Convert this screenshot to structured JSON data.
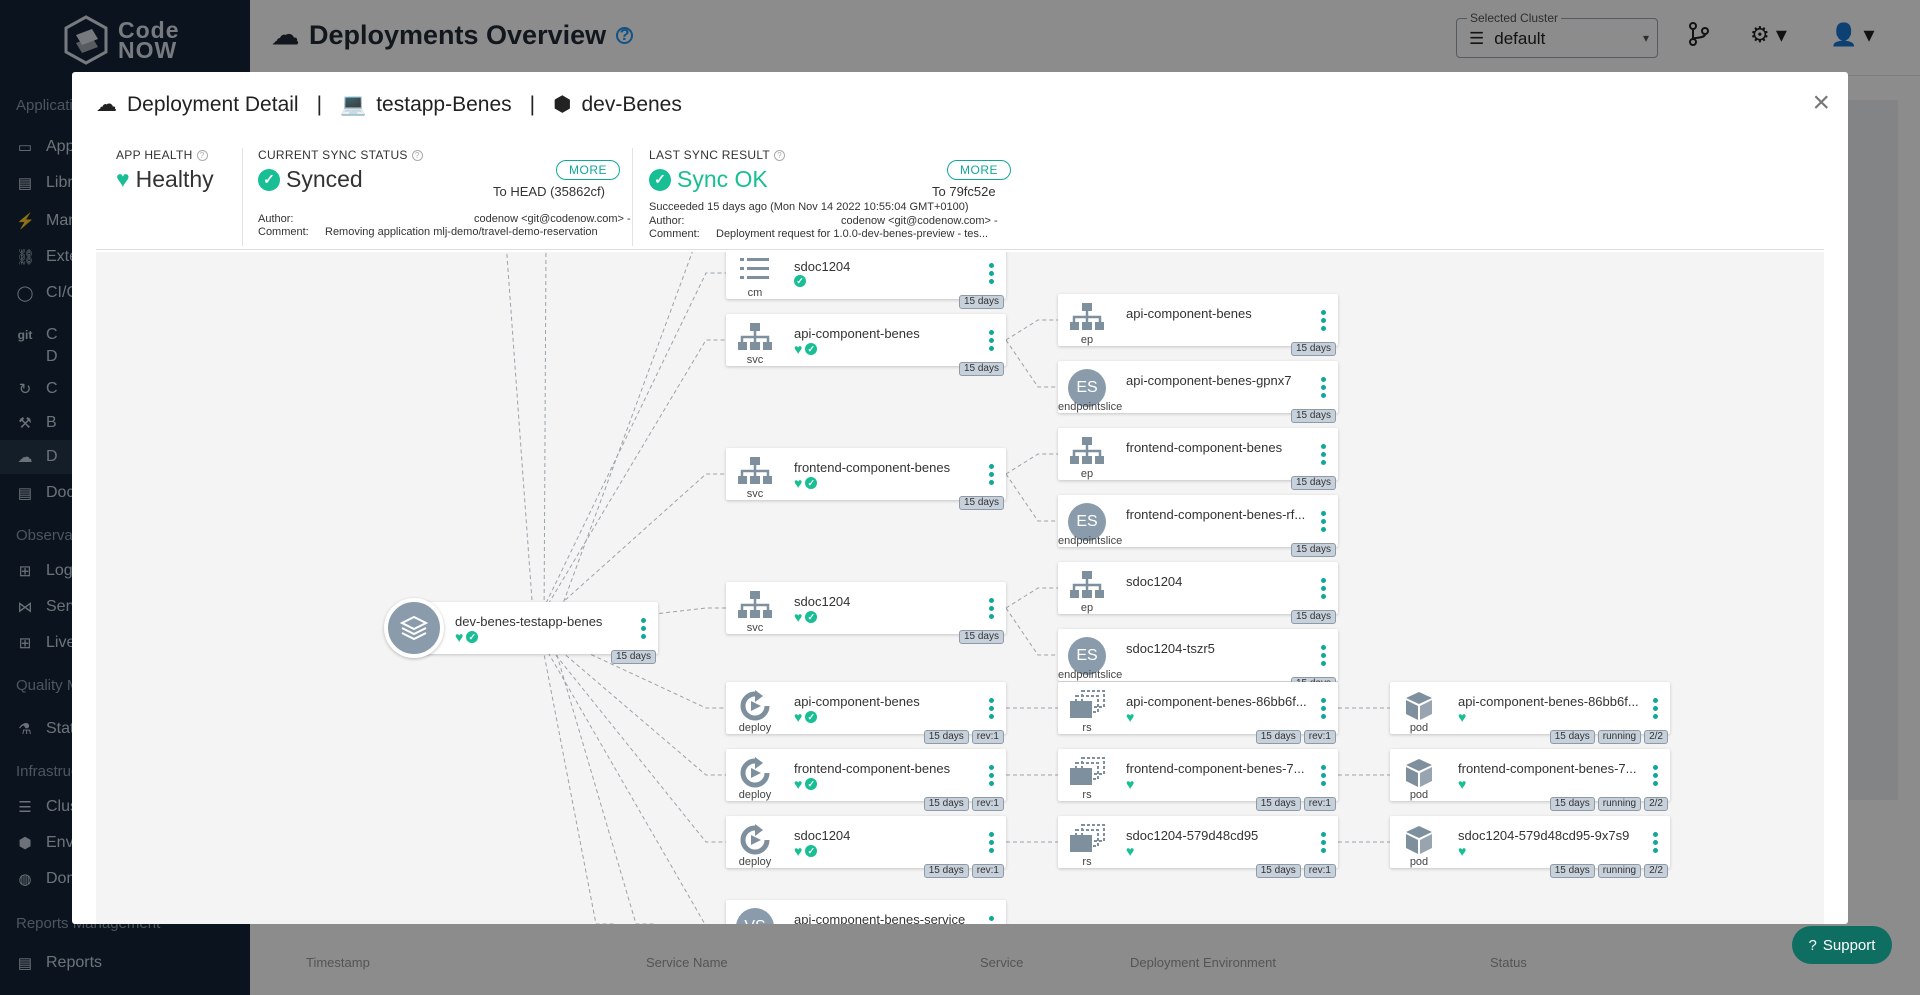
{
  "app": {
    "logo_line1": "Code",
    "logo_line2": "NOW"
  },
  "sidebar": {
    "items": [
      {
        "label": "Applications",
        "icon": "section"
      },
      {
        "label": "Applications",
        "icon": "laptop-icon"
      },
      {
        "label": "Libraries",
        "icon": "book-icon"
      },
      {
        "label": "Managed Services",
        "icon": "plug-icon"
      },
      {
        "label": "External Services",
        "icon": "link-icon"
      },
      {
        "label": "CI/CD",
        "icon": "cycle-icon"
      },
      {
        "label": "C",
        "icon": "git-icon"
      },
      {
        "label": "D",
        "icon": "none"
      },
      {
        "label": "C",
        "icon": "refresh-icon"
      },
      {
        "label": "B",
        "icon": "hammer-icon"
      },
      {
        "label": "D",
        "icon": "cloud-icon"
      },
      {
        "label": "Documentation",
        "icon": "book-icon"
      },
      {
        "label": "Observability",
        "icon": "section"
      },
      {
        "label": "Logs",
        "icon": "binoculars-icon"
      },
      {
        "label": "Services",
        "icon": "graph-icon"
      },
      {
        "label": "Live",
        "icon": "binoculars-icon"
      },
      {
        "label": "Quality Management",
        "icon": "section"
      },
      {
        "label": "Static",
        "icon": "flask-icon"
      },
      {
        "label": "Infrastructure",
        "icon": "section"
      },
      {
        "label": "Clusters",
        "icon": "list-icon"
      },
      {
        "label": "Environments",
        "icon": "cube-icon"
      },
      {
        "label": "Domains",
        "icon": "globe-icon"
      },
      {
        "label": "Reports Management",
        "icon": "section"
      },
      {
        "label": "Reports",
        "icon": "doc-icon"
      }
    ]
  },
  "header": {
    "title": "Deployments Overview",
    "cluster_label": "Selected Cluster",
    "cluster_value": "default"
  },
  "background_table": {
    "columns": [
      "Timestamp",
      "Service Name",
      "Service",
      "Deployment Environment",
      "Status"
    ]
  },
  "modal": {
    "title_part1": "Deployment Detail",
    "title_part2": "testapp-Benes",
    "title_part3": "dev-Benes",
    "separator": "|",
    "close": "×",
    "health": {
      "header": "APP HEALTH",
      "value": "Healthy"
    },
    "sync_status": {
      "header": "CURRENT SYNC STATUS",
      "value": "Synced",
      "more": "MORE",
      "target": "To HEAD (35862cf)",
      "author_label": "Author:",
      "author": "codenow <git@codenow.com> -",
      "comment_label": "Comment:",
      "comment": "Removing application mlj-demo/travel-demo-reservation"
    },
    "last_sync": {
      "header": "LAST SYNC RESULT",
      "value": "Sync OK",
      "more": "MORE",
      "target": "To 79fc52e",
      "succeeded": "Succeeded 15 days ago (Mon Nov 14 2022 10:55:04 GMT+0100)",
      "author_label": "Author:",
      "author": "codenow <git@codenow.com> -",
      "comment_label": "Comment:",
      "comment": "Deployment request for 1.0.0-dev-benes-preview - tes..."
    }
  },
  "graph": {
    "root": {
      "name": "dev-benes-testapp-benes",
      "age": "15 days"
    },
    "nodes": [
      {
        "id": "n1",
        "name": "sdoc1204",
        "kind": "cm",
        "icon": "list",
        "heart": false,
        "check": true,
        "tags": [
          "15 days"
        ]
      },
      {
        "id": "n2",
        "name": "api-component-benes",
        "kind": "svc",
        "icon": "tree",
        "heart": true,
        "check": true,
        "tags": [
          "15 days"
        ]
      },
      {
        "id": "n3",
        "name": "frontend-component-benes",
        "kind": "svc",
        "icon": "tree",
        "heart": true,
        "check": true,
        "tags": [
          "15 days"
        ]
      },
      {
        "id": "n4",
        "name": "sdoc1204",
        "kind": "svc",
        "icon": "tree",
        "heart": true,
        "check": true,
        "tags": [
          "15 days"
        ]
      },
      {
        "id": "n5",
        "name": "api-component-benes",
        "kind": "deploy",
        "icon": "deploy",
        "heart": true,
        "check": true,
        "tags": [
          "15 days",
          "rev:1"
        ]
      },
      {
        "id": "n6",
        "name": "frontend-component-benes",
        "kind": "deploy",
        "icon": "deploy",
        "heart": true,
        "check": true,
        "tags": [
          "15 days",
          "rev:1"
        ]
      },
      {
        "id": "n7",
        "name": "sdoc1204",
        "kind": "deploy",
        "icon": "deploy",
        "heart": true,
        "check": true,
        "tags": [
          "15 days",
          "rev:1"
        ]
      },
      {
        "id": "n8",
        "name": "api-component-benes-service",
        "kind": "",
        "icon": "vs",
        "heart": false,
        "check": false,
        "tags": []
      },
      {
        "id": "e1",
        "name": "api-component-benes",
        "kind": "ep",
        "icon": "tree",
        "heart": false,
        "check": false,
        "tags": [
          "15 days"
        ]
      },
      {
        "id": "e2",
        "name": "api-component-benes-gpnx7",
        "kind": "endpointslice",
        "icon": "es",
        "heart": false,
        "check": false,
        "tags": [
          "15 days"
        ]
      },
      {
        "id": "e3",
        "name": "frontend-component-benes",
        "kind": "ep",
        "icon": "tree",
        "heart": false,
        "check": false,
        "tags": [
          "15 days"
        ]
      },
      {
        "id": "e4",
        "name": "frontend-component-benes-rf...",
        "kind": "endpointslice",
        "icon": "es",
        "heart": false,
        "check": false,
        "tags": [
          "15 days"
        ]
      },
      {
        "id": "e5",
        "name": "sdoc1204",
        "kind": "ep",
        "icon": "tree",
        "heart": false,
        "check": false,
        "tags": [
          "15 days"
        ]
      },
      {
        "id": "e6",
        "name": "sdoc1204-tszr5",
        "kind": "endpointslice",
        "icon": "es",
        "heart": false,
        "check": false,
        "tags": [
          "15 days"
        ]
      },
      {
        "id": "r1",
        "name": "api-component-benes-86bb6f...",
        "kind": "rs",
        "icon": "rs",
        "heart": true,
        "check": false,
        "tags": [
          "15 days",
          "rev:1"
        ]
      },
      {
        "id": "r2",
        "name": "frontend-component-benes-7...",
        "kind": "rs",
        "icon": "rs",
        "heart": true,
        "check": false,
        "tags": [
          "15 days",
          "rev:1"
        ]
      },
      {
        "id": "r3",
        "name": "sdoc1204-579d48cd95",
        "kind": "rs",
        "icon": "rs",
        "heart": true,
        "check": false,
        "tags": [
          "15 days",
          "rev:1"
        ]
      },
      {
        "id": "p1",
        "name": "api-component-benes-86bb6f...",
        "kind": "pod",
        "icon": "pod",
        "heart": true,
        "check": false,
        "tags": [
          "15 days",
          "running",
          "2/2"
        ]
      },
      {
        "id": "p2",
        "name": "frontend-component-benes-7...",
        "kind": "pod",
        "icon": "pod",
        "heart": true,
        "check": false,
        "tags": [
          "15 days",
          "running",
          "2/2"
        ]
      },
      {
        "id": "p3",
        "name": "sdoc1204-579d48cd95-9x7s9",
        "kind": "pod",
        "icon": "pod",
        "heart": true,
        "check": false,
        "tags": [
          "15 days",
          "running",
          "2/2"
        ]
      }
    ]
  },
  "support": {
    "label": "Support"
  },
  "colors": {
    "accent": "#18be94",
    "teal": "#11a89a",
    "sidebar": "#142638"
  }
}
